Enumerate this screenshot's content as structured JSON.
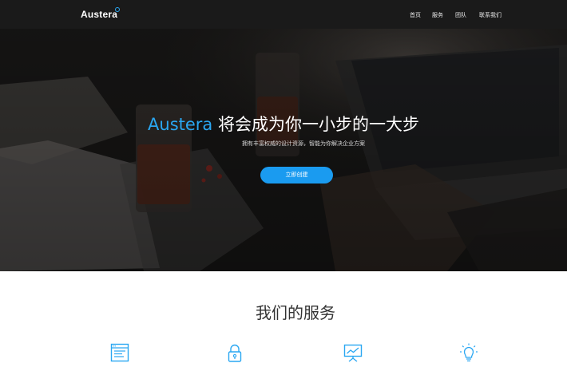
{
  "brand": {
    "name": "Austera"
  },
  "nav": {
    "items": [
      "首页",
      "服务",
      "团队",
      "联系我们"
    ]
  },
  "hero": {
    "title_accent": "Austera",
    "title_rest": "将会成为你一小步的一大步",
    "subtitle": "拥有丰富权威的设计资源，智能为你解决企业方案",
    "cta_label": "立即创建"
  },
  "services": {
    "title": "我们的服务",
    "icons": [
      "browser-window-icon",
      "lock-icon",
      "presentation-chart-icon",
      "lightbulb-icon"
    ]
  },
  "colors": {
    "accent": "#2aa7f2",
    "button": "#1a9bf0",
    "navbar": "#1a1a1a"
  }
}
